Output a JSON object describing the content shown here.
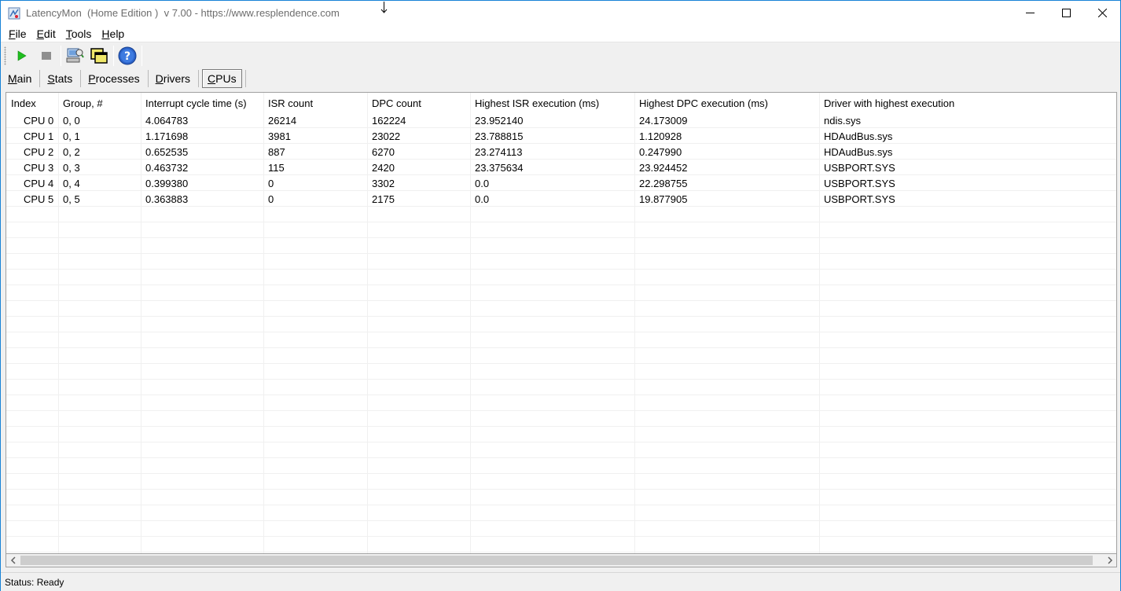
{
  "window": {
    "title": "LatencyMon  (Home Edition )  v 7.00 - https://www.resplendence.com",
    "icon": "latencymon-app-icon"
  },
  "menu": [
    {
      "label": "File",
      "mnemonic": "F",
      "rest": "ile"
    },
    {
      "label": "Edit",
      "mnemonic": "E",
      "rest": "dit"
    },
    {
      "label": "Tools",
      "mnemonic": "T",
      "rest": "ools"
    },
    {
      "label": "Help",
      "mnemonic": "H",
      "rest": "elp"
    }
  ],
  "toolbar": {
    "start_icon": "play-icon",
    "stop_icon": "stop-icon",
    "report_icon": "system-report-icon",
    "windows_icon": "windows-icon",
    "help_icon": "help-icon"
  },
  "tabs": [
    {
      "label": "Main",
      "mnemonic": "M",
      "rest": "ain",
      "active": false
    },
    {
      "label": "Stats",
      "mnemonic": "S",
      "rest": "tats",
      "active": false
    },
    {
      "label": "Processes",
      "mnemonic": "P",
      "rest": "rocesses",
      "active": false
    },
    {
      "label": "Drivers",
      "mnemonic": "D",
      "rest": "rivers",
      "active": false
    },
    {
      "label": "CPUs",
      "mnemonic": "C",
      "rest": "PUs",
      "active": true
    }
  ],
  "table": {
    "columns": [
      "Index",
      "Group, #",
      "Interrupt cycle time (s)",
      "ISR count",
      "DPC count",
      "Highest ISR execution (ms)",
      "Highest DPC execution (ms)",
      "Driver with highest execution"
    ],
    "rows": [
      [
        "CPU 0",
        "0, 0",
        "4.064783",
        "26214",
        "162224",
        "23.952140",
        "24.173009",
        "ndis.sys"
      ],
      [
        "CPU 1",
        "0, 1",
        "1.171698",
        "3981",
        "23022",
        "23.788815",
        "1.120928",
        "HDAudBus.sys"
      ],
      [
        "CPU 2",
        "0, 2",
        "0.652535",
        "887",
        "6270",
        "23.274113",
        "0.247990",
        "HDAudBus.sys"
      ],
      [
        "CPU 3",
        "0, 3",
        "0.463732",
        "115",
        "2420",
        "23.375634",
        "23.924452",
        "USBPORT.SYS"
      ],
      [
        "CPU 4",
        "0, 4",
        "0.399380",
        "0",
        "3302",
        "0.0",
        "22.298755",
        "USBPORT.SYS"
      ],
      [
        "CPU 5",
        "0, 5",
        "0.363883",
        "0",
        "2175",
        "0.0",
        "19.877905",
        "USBPORT.SYS"
      ]
    ]
  },
  "status": {
    "text": "Status: Ready"
  }
}
